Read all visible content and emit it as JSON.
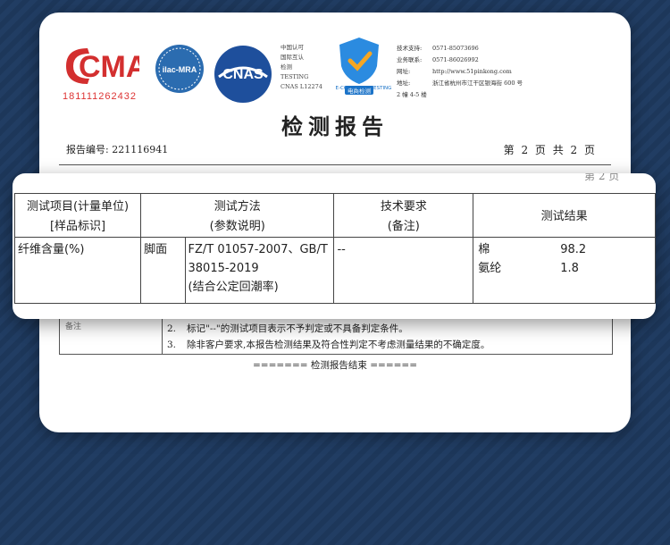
{
  "logos": {
    "cma_text": "CMA",
    "cma_number": "181111262432",
    "ilac_text": "ilac-MRA",
    "cnas_text": "CNAS",
    "cnas_lines": [
      "中国认可",
      "国际互认",
      "检测",
      "TESTING",
      "CNAS L12274"
    ],
    "ec_label": "电商检测",
    "ec_label_en": "E-COMMERCE TESTING"
  },
  "contact": {
    "support_label": "技术支持:",
    "support_value": "0571-85073696",
    "business_label": "业务联系:",
    "business_value": "0571-86026992",
    "website_label": "网址:",
    "website_value": "http://www.51pinkong.com",
    "address_label": "地址:",
    "address_value": "浙江省杭州市江干区银海街 600 号",
    "address_value2": "2 幢 4-5 楼"
  },
  "report": {
    "title": "检测报告",
    "report_no_label": "报告编号:",
    "report_no": "221116941",
    "page_info": "第 2 页 共 2 页",
    "page_info_partial": "第 2 页"
  },
  "table": {
    "headers": [
      {
        "line1": "测试项目(计量单位)",
        "line2": "[样品标识]"
      },
      {
        "line1": "测试方法",
        "line2": "(参数说明)"
      },
      {
        "line1": "技术要求",
        "line2": "(备注)"
      },
      {
        "line1": "测试结果",
        "line2": ""
      }
    ],
    "row": {
      "item": "纤维含量(%)",
      "sample": "脚面",
      "method_line1": "FZ/T 01057-2007、GB/T",
      "method_line2": "38015-2019",
      "method_line3": "(结合公定回潮率)",
      "requirement": "--",
      "results": [
        {
          "name": "棉",
          "value": "98.2"
        },
        {
          "name": "氨纶",
          "value": "1.8"
        }
      ]
    }
  },
  "notes": {
    "label": "备注",
    "items": [
      {
        "num": "2.",
        "text": "标记\"--\"的测试项目表示不予判定或不具备判定条件。"
      },
      {
        "num": "3.",
        "text": "除非客户要求,本报告检测结果及符合性判定不考虑测量结果的不确定度。"
      }
    ]
  },
  "end_text": "======= 检测报告结束 ======"
}
